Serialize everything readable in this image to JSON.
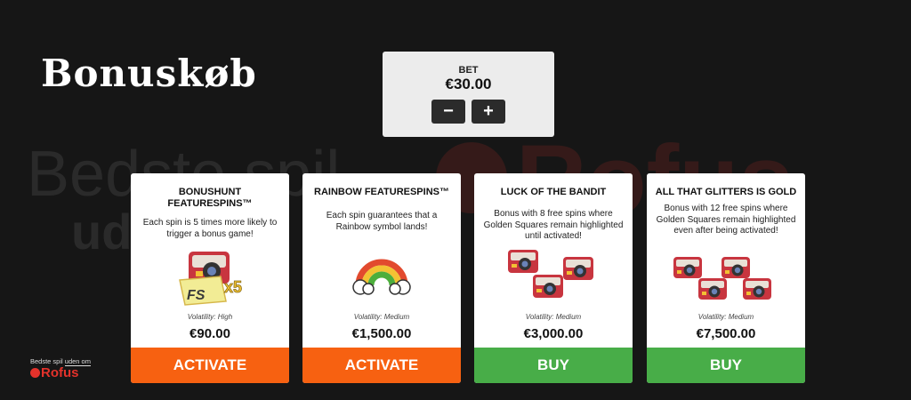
{
  "title": "Bonuskøb",
  "bet": {
    "label": "BET",
    "value": "€30.00",
    "minus_label": "−",
    "plus_label": "+"
  },
  "cards": [
    {
      "title": "BONUSHUNT FEATURESPINS™",
      "description": "Each spin is 5 times more likely to trigger a bonus game!",
      "art_label": "FS",
      "art_multiplier": "x5",
      "volatility": "Volatility: High",
      "price": "€90.00",
      "button": "ACTIVATE",
      "button_color": "#f76111"
    },
    {
      "title": "RAINBOW FEATURESPINS™",
      "description": "Each spin guarantees that a Rainbow symbol lands!",
      "volatility": "Volatility: Medium",
      "price": "€1,500.00",
      "button": "ACTIVATE",
      "button_color": "#f76111"
    },
    {
      "title": "LUCK OF THE BANDIT",
      "description": "Bonus with 8 free spins where Golden Squares remain highlighted until activated!",
      "volatility": "Volatility: Medium",
      "price": "€3,000.00",
      "button": "BUY",
      "button_color": "#48ad48"
    },
    {
      "title": "ALL THAT GLITTERS IS GOLD",
      "description": "Bonus with 12 free spins where Golden Squares remain highlighted even after being activated!",
      "volatility": "Volatility: Medium",
      "price": "€7,500.00",
      "button": "BUY",
      "button_color": "#48ad48"
    }
  ],
  "rofus": {
    "top_plain": "Bedste spil ",
    "top_underlined": "uden om",
    "word": "Rofus"
  },
  "watermark": {
    "text_left": "Bedste spil",
    "text_right": "Rofus",
    "text_under": "uden om"
  },
  "icons": [
    "camera-icon",
    "rainbow-icon",
    "rofus-logo-icon"
  ]
}
